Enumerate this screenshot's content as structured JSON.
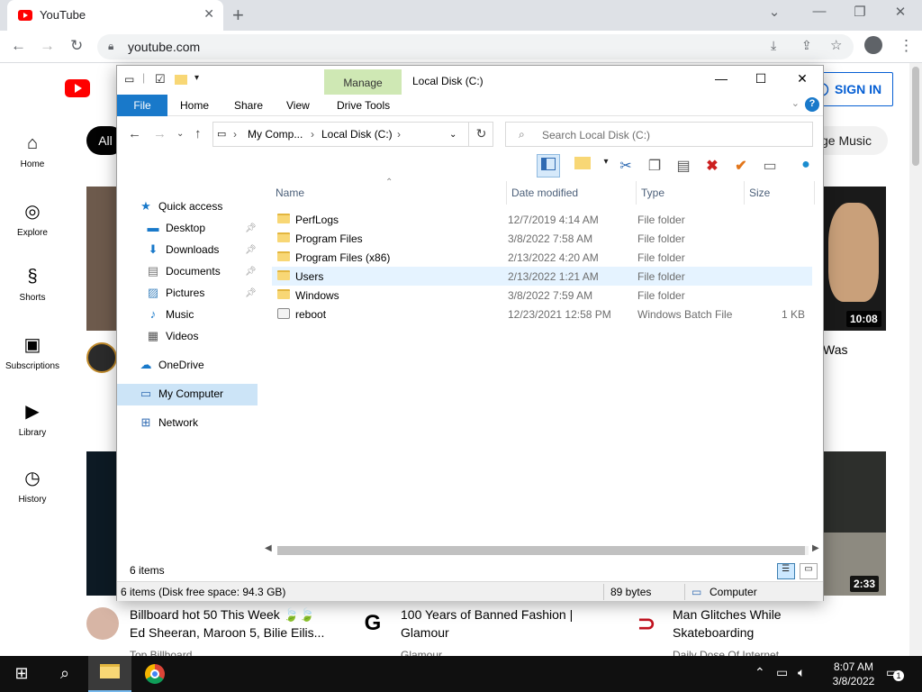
{
  "browser": {
    "tab_title": "YouTube",
    "url": "youtube.com"
  },
  "youtube": {
    "sign_in": "SIGN IN",
    "chip_all": "All",
    "chip_music": "ge Music",
    "sidebar": [
      {
        "label": "Home",
        "icon": "home-icon"
      },
      {
        "label": "Explore",
        "icon": "compass-icon"
      },
      {
        "label": "Shorts",
        "icon": "shorts-icon"
      },
      {
        "label": "Subscriptions",
        "icon": "subscriptions-icon"
      },
      {
        "label": "Library",
        "icon": "library-icon"
      },
      {
        "label": "History",
        "icon": "history-icon"
      }
    ],
    "durations": [
      "10:08",
      "2:33"
    ],
    "partial_title_right": "Was",
    "videos": [
      {
        "title_l1": "Billboard hot 50 This Week 🍃🍃",
        "title_l2": "Ed Sheeran, Maroon 5, Bilie Eilis...",
        "channel": "Top Billboard"
      },
      {
        "title_l1": "100 Years of Banned Fashion |",
        "title_l2": "Glamour",
        "channel": "Glamour"
      },
      {
        "title_l1": "Man Glitches While",
        "title_l2": "Skateboarding",
        "channel": "Daily Dose Of Internet"
      }
    ]
  },
  "explorer": {
    "title": "Local Disk (C:)",
    "manage_tab": "Manage",
    "ribbon_tabs": [
      "File",
      "Home",
      "Share",
      "View",
      "Drive Tools"
    ],
    "breadcrumb": [
      "My Comp...",
      "Local Disk (C:)"
    ],
    "search_placeholder": "Search Local Disk (C:)",
    "nav": {
      "quick_access": "Quick access",
      "desktop": "Desktop",
      "downloads": "Downloads",
      "documents": "Documents",
      "pictures": "Pictures",
      "music": "Music",
      "videos": "Videos",
      "onedrive": "OneDrive",
      "my_computer": "My Computer",
      "network": "Network"
    },
    "columns": {
      "name": "Name",
      "date": "Date modified",
      "type": "Type",
      "size": "Size"
    },
    "files": [
      {
        "name": "PerfLogs",
        "date": "12/7/2019 4:14 AM",
        "type": "File folder",
        "size": ""
      },
      {
        "name": "Program Files",
        "date": "3/8/2022 7:58 AM",
        "type": "File folder",
        "size": ""
      },
      {
        "name": "Program Files (x86)",
        "date": "2/13/2022 4:20 AM",
        "type": "File folder",
        "size": ""
      },
      {
        "name": "Users",
        "date": "2/13/2022 1:21 AM",
        "type": "File folder",
        "size": ""
      },
      {
        "name": "Windows",
        "date": "3/8/2022 7:59 AM",
        "type": "File folder",
        "size": ""
      },
      {
        "name": "reboot",
        "date": "12/23/2021 12:58 PM",
        "type": "Windows Batch File",
        "size": "1 KB"
      }
    ],
    "item_count": "6 items",
    "status_left": "6 items (Disk free space: 94.3 GB)",
    "status_bytes": "89 bytes",
    "status_location": "Computer"
  },
  "taskbar": {
    "time": "8:07 AM",
    "date": "3/8/2022",
    "notification_count": "1"
  }
}
